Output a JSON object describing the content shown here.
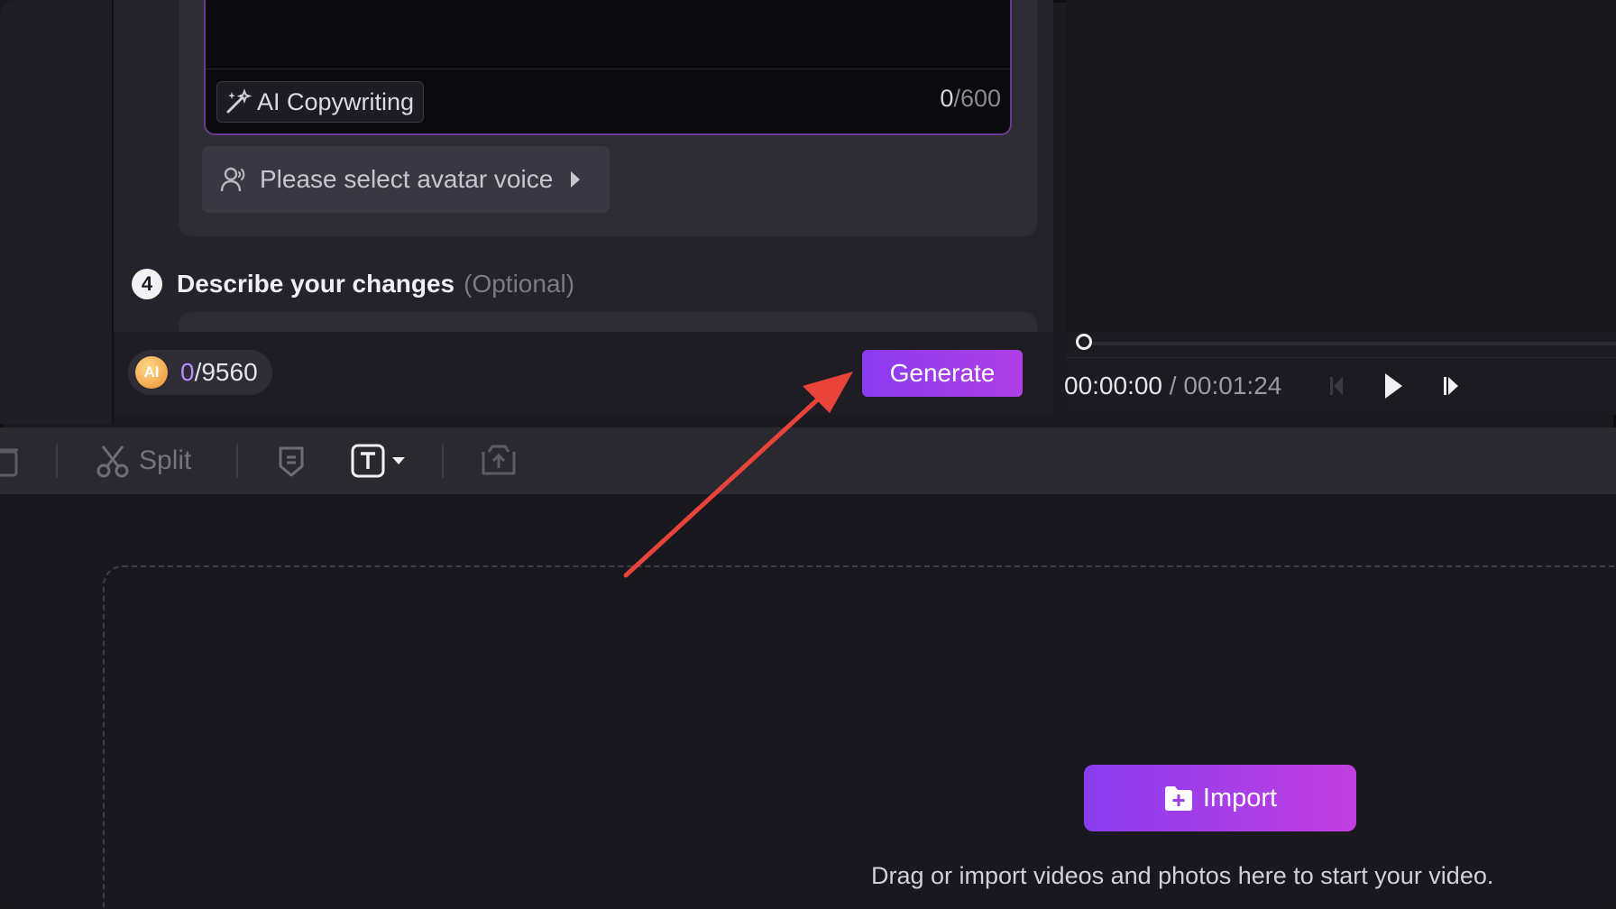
{
  "script_editor": {
    "ai_copywriting_label": "AI Copywriting",
    "char_count_current": "0",
    "char_count_max": "/600"
  },
  "voice": {
    "label": "Please select avatar voice"
  },
  "step4": {
    "number": "4",
    "title": "Describe your changes",
    "optional": "(Optional)"
  },
  "credits": {
    "coin_label": "AI",
    "used": "0",
    "total": "/9560"
  },
  "generate_label": "Generate",
  "player": {
    "current_time": "00:00:00",
    "separator": " / ",
    "total_time": "00:01:24",
    "progress": 0
  },
  "toolbar": {
    "split_label": "Split"
  },
  "timeline": {
    "import_label": "Import",
    "hint": "Drag or import videos and photos here to start your video."
  },
  "colors": {
    "accent": "#8a3cf0",
    "annotation_arrow": "#e8443a"
  }
}
